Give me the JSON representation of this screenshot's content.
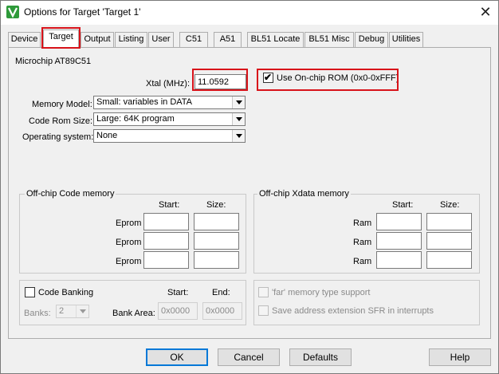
{
  "window": {
    "title": "Options for Target 'Target 1'"
  },
  "tabs": [
    {
      "label": "Device"
    },
    {
      "label": "Target"
    },
    {
      "label": "Output"
    },
    {
      "label": "Listing"
    },
    {
      "label": "User"
    },
    {
      "label": "C51"
    },
    {
      "label": "A51"
    },
    {
      "label": "BL51 Locate"
    },
    {
      "label": "BL51 Misc"
    },
    {
      "label": "Debug"
    },
    {
      "label": "Utilities"
    }
  ],
  "active_tab": "Target",
  "device": {
    "name": "Microchip AT89C51"
  },
  "xtal": {
    "label": "Xtal (MHz):",
    "value": "11.0592"
  },
  "onchip_rom": {
    "label": "Use On-chip ROM (0x0-0xFFF)",
    "checked": true
  },
  "memory_model": {
    "label": "Memory Model:",
    "value": "Small: variables in DATA"
  },
  "code_rom_size": {
    "label": "Code Rom Size:",
    "value": "Large: 64K program"
  },
  "operating_system": {
    "label": "Operating system:",
    "value": "None"
  },
  "offchip_code": {
    "title": "Off-chip Code memory",
    "start_label": "Start:",
    "size_label": "Size:",
    "rows": [
      {
        "label": "Eprom"
      },
      {
        "label": "Eprom"
      },
      {
        "label": "Eprom"
      }
    ]
  },
  "offchip_xdata": {
    "title": "Off-chip Xdata memory",
    "start_label": "Start:",
    "size_label": "Size:",
    "rows": [
      {
        "label": "Ram"
      },
      {
        "label": "Ram"
      },
      {
        "label": "Ram"
      }
    ]
  },
  "code_banking": {
    "label": "Code Banking",
    "checked": false,
    "start_label": "Start:",
    "end_label": "End:",
    "banks_label": "Banks:",
    "banks_value": "2",
    "bank_area_label": "Bank Area:",
    "bank_area_start": "0x0000",
    "bank_area_end": "0x0000"
  },
  "options": {
    "far_memory": {
      "label": "'far' memory type support",
      "checked": false
    },
    "save_address": {
      "label": "Save address extension SFR in interrupts",
      "checked": false
    }
  },
  "buttons": {
    "ok": "OK",
    "cancel": "Cancel",
    "defaults": "Defaults",
    "help": "Help"
  },
  "colors": {
    "highlight": "#d8131a",
    "focus": "#0078d7"
  }
}
